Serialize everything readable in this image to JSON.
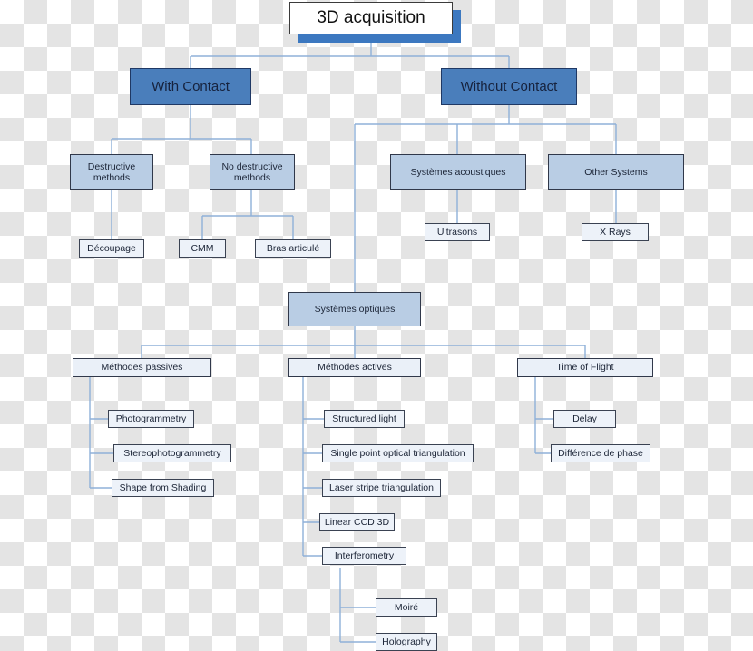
{
  "diagram": {
    "title": "3D acquisition taxonomy flowchart",
    "colors": {
      "root_fill": "#ffffff",
      "root_shadow": "#3c78c0",
      "primary_fill": "#4a7ebb",
      "secondary_fill": "#b9cde4",
      "leaf_fill": "#edf2f9",
      "bar_fill": "#eaf0f8",
      "connector": "#8fb0d8",
      "border_dark": "#30384a"
    },
    "nodes": {
      "root": "3D acquisition",
      "with_contact": "With Contact",
      "without_contact": "Without Contact",
      "destructive_methods": "Destructive\nmethods",
      "no_destructive_methods": "No destructive\nmethods",
      "systemes_acoustiques": "Systèmes acoustiques",
      "other_systems": "Other Systems",
      "decoupage": "Découpage",
      "cmm": "CMM",
      "bras_articule": "Bras articulé",
      "ultrasons": "Ultrasons",
      "x_rays": "X Rays",
      "systemes_optiques": "Systèmes optiques",
      "methodes_passives": "Méthodes passives",
      "methodes_actives": "Méthodes actives",
      "time_of_flight": "Time of Flight",
      "photogrammetry": "Photogrammetry",
      "stereophotogrammetry": "Stereophotogrammetry",
      "shape_from_shading": "Shape from Shading",
      "structured_light": "Structured light",
      "single_point_optical_triangulation": "Single point optical triangulation",
      "laser_stripe_triangulation": "Laser stripe triangulation",
      "linear_ccd_3d": "Linear CCD 3D",
      "interferometry": "Interferometry",
      "delay": "Delay",
      "difference_de_phase": "Différence de phase",
      "moire": "Moiré",
      "holography": "Holography"
    }
  }
}
